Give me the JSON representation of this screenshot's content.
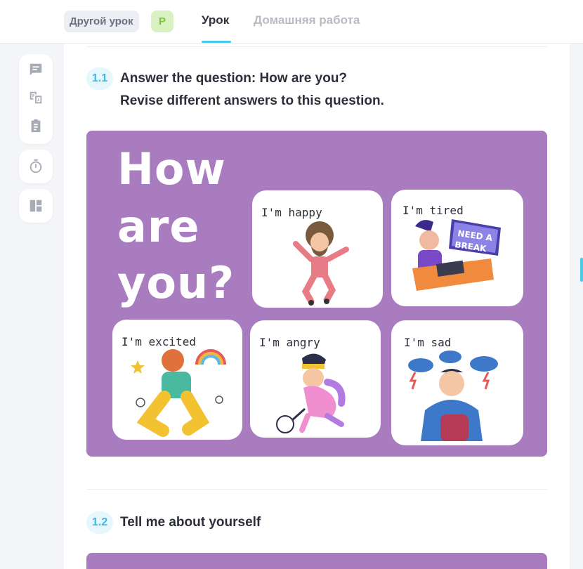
{
  "topbar": {
    "other_lesson": "Другой урок",
    "user_initial": "Р",
    "tabs": {
      "lesson": "Урок",
      "homework": "Домашняя работа"
    }
  },
  "sidebar": {
    "icons": [
      "chat-icon",
      "translate-icon",
      "clipboard-icon",
      "timer-icon",
      "dashboard-icon"
    ]
  },
  "tasks": [
    {
      "number": "1.1",
      "title_line1": "Answer the question: How are you?",
      "title_line2": "Revise different answers to this question.",
      "image": {
        "headline": [
          "How",
          "are",
          "you?"
        ],
        "panels": [
          "I'm happy",
          "I'm tired",
          "I'm excited",
          "I'm angry",
          "I'm sad"
        ],
        "sign_text": [
          "NEED A",
          "BREAK"
        ]
      }
    },
    {
      "number": "1.2",
      "title": "Tell me about yourself"
    }
  ],
  "colors": {
    "accent": "#4fc5ea",
    "image_bg": "#a97cbf",
    "badge_green": "#d8f1c0"
  }
}
